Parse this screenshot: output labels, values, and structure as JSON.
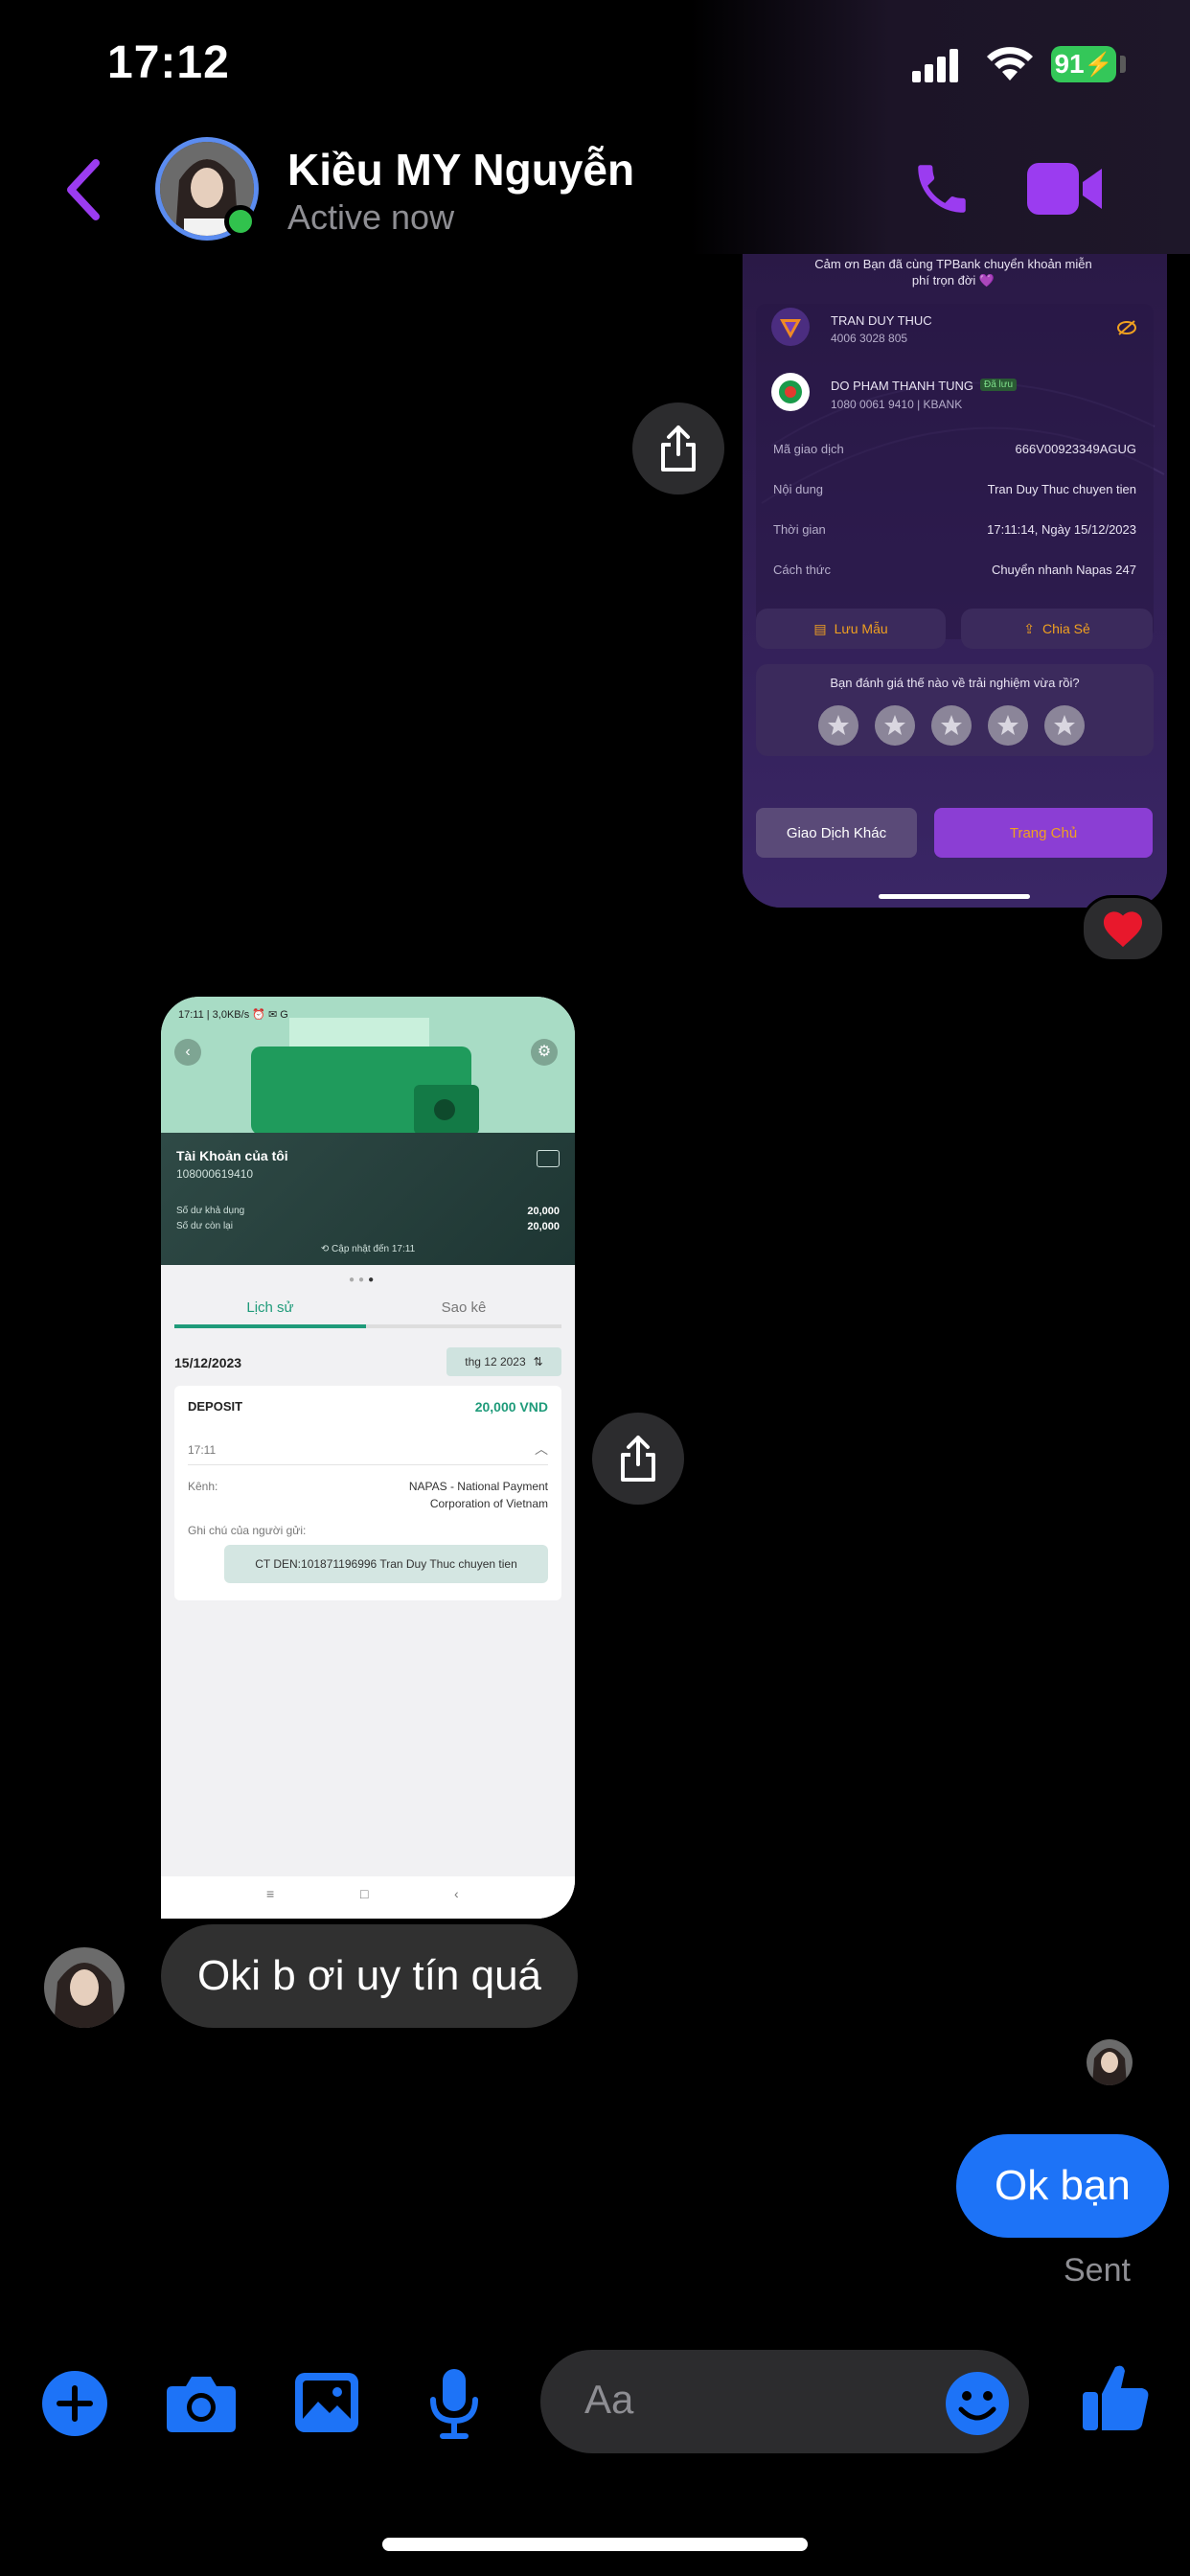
{
  "status_bar": {
    "time": "17:12",
    "battery": "91"
  },
  "header": {
    "name": "Kiều MY Nguyễn",
    "status": "Active now"
  },
  "tpbank": {
    "thanks": "Cảm ơn Bạn đã cùng TPBank chuyển khoản miễn phí trọn đời 💜",
    "sender_name": "TRAN DUY THUC",
    "sender_account": "4006 3028 805",
    "receiver_name": "DO PHAM THANH TUNG",
    "receiver_badge": "Đã lưu",
    "receiver_account": "1080 0061 9410 | KBANK",
    "rows": [
      {
        "label": "Mã giao dịch",
        "value": "666V00923349AGUG"
      },
      {
        "label": "Nội dung",
        "value": "Tran Duy Thuc chuyen tien"
      },
      {
        "label": "Thời gian",
        "value": "17:11:14, Ngày 15/12/2023"
      },
      {
        "label": "Cách thức",
        "value": "Chuyển nhanh Napas 247"
      }
    ],
    "save_btn": "Lưu Mẫu",
    "share_btn": "Chia Sẻ",
    "rating_question": "Bạn đánh giá thế nào về trải nghiệm vừa rồi?",
    "other_btn": "Giao Dịch Khác",
    "home_btn": "Trang Chủ"
  },
  "bank2": {
    "status": "17:11 | 3,0KB/s ⏰ ✉ G",
    "account_title": "Tài Khoản của tôi",
    "account_number": "108000619410",
    "available_label": "Số dư khả dụng",
    "available_value": "20,000",
    "remaining_label": "Số dư còn lại",
    "remaining_value": "20,000",
    "updated": "Cập nhật đến 17:11",
    "tab_history": "Lịch sử",
    "tab_statement": "Sao kê",
    "date": "15/12/2023",
    "month_filter": "thg 12 2023",
    "type": "DEPOSIT",
    "amount": "20,000 VND",
    "tx_time": "17:11",
    "channel_label": "Kênh:",
    "channel_value_1": "NAPAS - National Payment",
    "channel_value_2": "Corporation of Vietnam",
    "note_label": "Ghi chú của người gửi:",
    "note": "CT DEN:101871196996 Tran Duy Thuc chuyen tien"
  },
  "messages": {
    "incoming": "Oki b ơi uy tín quá",
    "outgoing": "Ok bạn",
    "sent_status": "Sent"
  },
  "composer": {
    "placeholder": "Aa"
  },
  "colors": {
    "accent_purple": "#9b3cf0",
    "messenger_blue": "#1d73f7",
    "heart": "#e8182c"
  }
}
